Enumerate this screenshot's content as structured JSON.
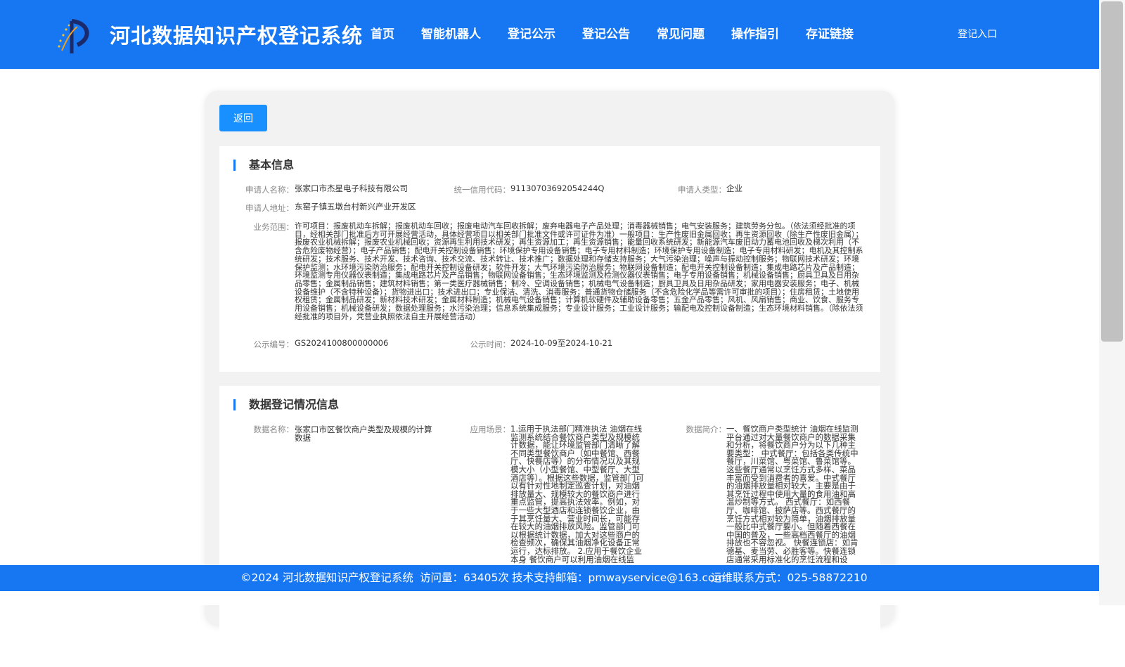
{
  "header": {
    "title": "河北数据知识产权登记系统",
    "nav": [
      "首页",
      "智能机器人",
      "登记公示",
      "登记公告",
      "常见问题",
      "操作指引",
      "存证链接"
    ],
    "login": "登记入口",
    "bg_color": "#1777f2"
  },
  "back_label": "返回",
  "basic": {
    "title": "基本信息",
    "applicant_name_label": "申请人名称：",
    "applicant_name": "张家口市杰星电子科技有限公司",
    "credit_code_label": "统一信用代码：",
    "credit_code": "91130703692054244Q",
    "applicant_type_label": "申请人类型：",
    "applicant_type": "企业",
    "address_label": "申请人地址：",
    "address": "东窑子镇五墩台村新兴产业开发区",
    "scope_label": "业务范围：",
    "scope": "许可项目：报废机动车拆解；报废机动车回收；报废电动汽车回收拆解；废弃电器电子产品处理；消毒器械销售；电气安装服务；建筑劳务分包。（依法须经批准的项目，经相关部门批准后方可开展经营活动，具体经营项目以相关部门批准文件或许可证件为准）一般项目：生产性废旧金属回收；再生资源回收（除生产性废旧金属）；报废农业机械拆解；报废农业机械回收；资源再生利用技术研发；再生资源加工；再生资源销售；能量回收系统研发；新能源汽车废旧动力蓄电池回收及梯次利用（不含危险废物经营）；电子产品销售；配电开关控制设备销售；环境保护专用设备销售；电子专用材料制造；环境保护专用设备制造；电子专用材料研发；电机及其控制系统研发；技术服务、技术开发、技术咨询、技术交流、技术转让、技术推广；数据处理和存储支持服务；大气污染治理；噪声与振动控制服务；物联网技术研发；环境保护监测；水环境污染防治服务；配电开关控制设备研发；软件开发；大气环境污染防治服务；物联网设备制造；配电开关控制设备制造；集成电路芯片及产品制造；环境监测专用仪器仪表制造；集成电路芯片及产品销售；物联网设备销售；生态环境监测及检测仪器仪表销售；电子专用设备销售；机械设备销售；厨具卫具及日用杂品零售；金属制品销售；建筑材料销售；第一类医疗器械销售；制冷、空调设备销售；机械电气设备制造；厨具卫具及日用杂品研发；家用电器安装服务；电子、机械设备维护（不含特种设备）；货物进出口；技术进出口；专业保洁、清洗、消毒服务；普通货物仓储服务（不含危险化学品等需许可审批的项目）；住房租赁；土地使用权租赁；金属制品研发；新材料技术研发；金属材料制造；机械电气设备销售；计算机软硬件及辅助设备零售；五金产品零售；风机、风扇销售；商业、饮食、服务专用设备销售；机械设备研发；数据处理服务；水污染治理；信息系统集成服务；专业设计服务；工业设计服务；输配电及控制设备制造；生态环境材料销售。（除依法须经批准的项目外，凭营业执照依法自主开展经营活动）",
    "pub_no_label": "公示编号：",
    "pub_no": "GS2024100800000006",
    "pub_time_label": "公示时间：",
    "pub_time": "2024-10-09至2024-10-21"
  },
  "data_reg": {
    "title": "数据登记情况信息",
    "name_label": "数据名称：",
    "name": "张家口市区餐饮商户类型及规模的计算数据",
    "scene_label": "应用场景：",
    "scene": "1.运用于执法部门精准执法 油烟在线监测系统结合餐饮商户类型及规模统计数据，能让环境监管部门清晰了解不同类型餐饮商户（如中餐馆、西餐厅、快餐店等）的分布情况以及其规模大小（小型餐馆、中型餐厅、大型酒店等）。根据这些数据，监管部门可以有针对性地制定巡查计划，对油烟排放量大、规模较大的餐饮商户进行重点监管，提高执法效率。例如，对于一些大型酒店和连锁餐饮企业，由于其烹饪量大、营业时间长，可能存在较大的油烟排放风险。监管部门可以根据统计数据，加大对这些商户的检查频次，确保其油烟净化设备正常运行，达标排放。 2.应用于餐饮企业本身 餐饮商户可以利用油烟在线监",
    "intro_label": "数据简介：",
    "intro": "一、餐饮商户类型统计 油烟在线监测平台通过对大量餐饮商户的数据采集和分析，将餐饮商户分为以下几种主要类型： 中式餐厅：包括各类传统中餐厅，川菜馆、粤菜馆、鲁菜馆等。这些餐厅通常以烹饪方式多样、菜品丰富而受到消费者的喜爱。中式餐厅的油烟排放量相对较大，主要是由于其烹饪过程中使用大量的食用油和高温炒制等方式。 西式餐厅：如西餐厅、咖啡馆、披萨店等。西式餐厅的烹饪方式相对较为简单，油烟排放量一般比中式餐厅要小。但随着西餐在中国的普及，一些高档西餐厅的油烟排放也不容忽视。 快餐连锁店：如肯德基、麦当劳、必胜客等。快餐连锁店通常采用标准化的烹饪流程和设"
  },
  "footer": {
    "copyright": "©2024 河北数据知识产权登记系统",
    "visits": "访问量：63405次",
    "email": "技术支持邮箱：pmwayservice@163.com",
    "phone": "运维联系方式：025-58872210"
  }
}
